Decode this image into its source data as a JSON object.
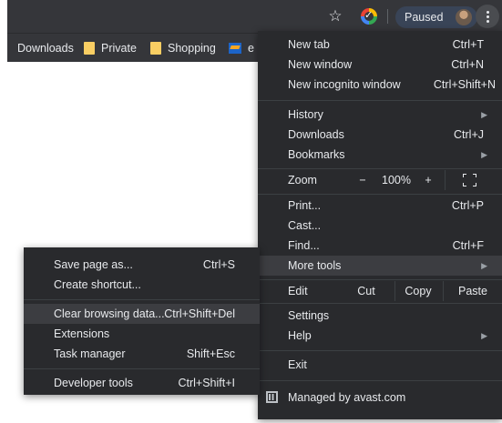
{
  "toolbar": {
    "bookmark_icon": "star-icon",
    "extension_icon": "avast-extension-icon",
    "profile_status": "Paused",
    "menu_icon": "kebab-menu-icon"
  },
  "bookmarks": [
    {
      "label": "Downloads",
      "icon": "none"
    },
    {
      "label": "Private",
      "icon": "folder-icon"
    },
    {
      "label": "Shopping",
      "icon": "folder-icon"
    },
    {
      "label": "e",
      "icon": "volksbank-icon"
    }
  ],
  "menu": {
    "new_tab": {
      "label": "New tab",
      "shortcut": "Ctrl+T"
    },
    "new_window": {
      "label": "New window",
      "shortcut": "Ctrl+N"
    },
    "new_incognito": {
      "label": "New incognito window",
      "shortcut": "Ctrl+Shift+N"
    },
    "history": {
      "label": "History"
    },
    "downloads": {
      "label": "Downloads",
      "shortcut": "Ctrl+J"
    },
    "bookmarks": {
      "label": "Bookmarks"
    },
    "zoom": {
      "label": "Zoom",
      "minus": "−",
      "value": "100%",
      "plus": "+"
    },
    "print": {
      "label": "Print...",
      "shortcut": "Ctrl+P"
    },
    "cast": {
      "label": "Cast..."
    },
    "find": {
      "label": "Find...",
      "shortcut": "Ctrl+F"
    },
    "more_tools": {
      "label": "More tools"
    },
    "edit": {
      "label": "Edit",
      "cut": "Cut",
      "copy": "Copy",
      "paste": "Paste"
    },
    "settings": {
      "label": "Settings"
    },
    "help": {
      "label": "Help"
    },
    "exit": {
      "label": "Exit"
    },
    "managed": {
      "label": "Managed by avast.com"
    }
  },
  "submenu": {
    "save_page": {
      "label": "Save page as...",
      "shortcut": "Ctrl+S"
    },
    "create_shortcut": {
      "label": "Create shortcut..."
    },
    "clear_data": {
      "label": "Clear browsing data...",
      "shortcut": "Ctrl+Shift+Del"
    },
    "extensions": {
      "label": "Extensions"
    },
    "task_manager": {
      "label": "Task manager",
      "shortcut": "Shift+Esc"
    },
    "developer_tools": {
      "label": "Developer tools",
      "shortcut": "Ctrl+Shift+I"
    }
  },
  "colors": {
    "toolbar_bg": "#35363a",
    "menu_bg": "#292a2d",
    "highlight_bg": "#3c3d41",
    "text": "#e8eaed",
    "paused_pill": "#394457"
  }
}
